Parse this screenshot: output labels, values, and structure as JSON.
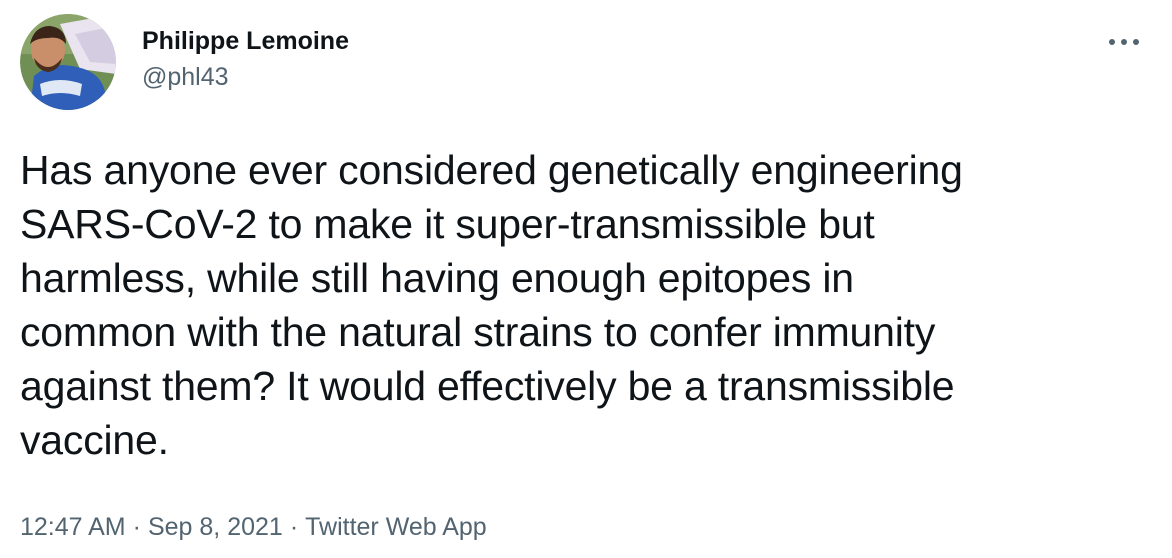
{
  "author": {
    "display_name": "Philippe Lemoine",
    "handle": "@phl43"
  },
  "icons": {
    "more": "more-options-icon",
    "avatar": "profile-photo"
  },
  "tweet": {
    "lines": [
      "Has anyone ever considered genetically engineering",
      "SARS-CoV-2 to make it super-transmissible but",
      "harmless, while still having enough epitopes in",
      "common with the natural strains to confer immunity",
      "against them? It would effectively be a transmissible",
      "vaccine."
    ]
  },
  "meta": {
    "time": "12:47 AM",
    "date": "Sep 8, 2021",
    "source": "Twitter Web App",
    "separator": "·"
  },
  "colors": {
    "text": "#0f1419",
    "secondary": "#536471",
    "background": "#ffffff"
  }
}
